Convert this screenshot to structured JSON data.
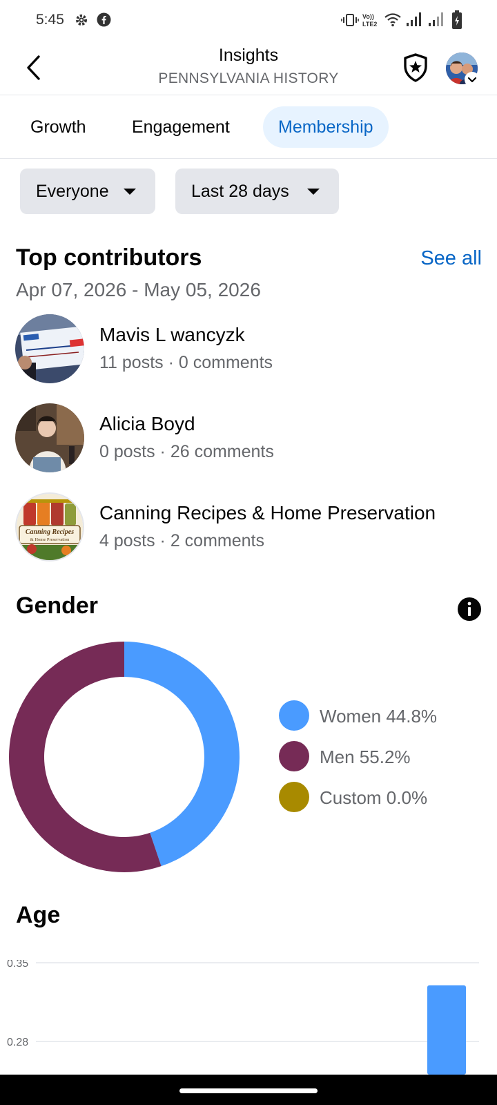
{
  "status_bar": {
    "time": "5:45",
    "left_icons": [
      "gear-icon",
      "facebook-icon"
    ],
    "right_icons": [
      "vibrate-icon",
      "volte-icon",
      "wifi-icon",
      "signal-icon",
      "signal-icon",
      "battery-icon"
    ]
  },
  "header": {
    "title": "Insights",
    "subtitle": "PENNSYLVANIA HISTORY"
  },
  "tabs": [
    {
      "label": "Growth",
      "active": false
    },
    {
      "label": "Engagement",
      "active": false
    },
    {
      "label": "Membership",
      "active": true
    }
  ],
  "filters": {
    "audience": "Everyone",
    "period": "Last 28 days"
  },
  "top_contributors": {
    "title": "Top contributors",
    "see_all": "See all",
    "date_range": "Apr 07, 2026 - May 05, 2026",
    "items": [
      {
        "name": "Mavis L wancyzk",
        "stats": "11 posts · 0 comments"
      },
      {
        "name": "Alicia Boyd",
        "stats": "0 posts · 26 comments"
      },
      {
        "name": "Canning Recipes & Home Preservation",
        "stats": "4 posts · 2 comments",
        "logo_text": [
          "Canning Recipes",
          "& Home Preservation"
        ]
      }
    ]
  },
  "gender": {
    "title": "Gender",
    "legend": [
      {
        "label": "Women 44.8%",
        "color": "#4a9bff"
      },
      {
        "label": "Men 55.2%",
        "color": "#762b56"
      },
      {
        "label": "Custom 0.0%",
        "color": "#a88a00"
      }
    ]
  },
  "age": {
    "title": "Age"
  },
  "colors": {
    "accent": "#0866c6",
    "tab_active_bg": "#e7f3ff",
    "women": "#4a9bff",
    "men": "#762b56",
    "custom": "#a88a00"
  },
  "chart_data": [
    {
      "type": "pie",
      "title": "Gender",
      "categories": [
        "Women",
        "Men",
        "Custom"
      ],
      "values": [
        44.8,
        55.2,
        0.0
      ],
      "unit": "%",
      "colors": [
        "#4a9bff",
        "#762b56",
        "#a88a00"
      ],
      "style": "donut",
      "legend": "right"
    },
    {
      "type": "bar",
      "title": "Age",
      "y_ticks": [
        "0.35",
        "0.28"
      ],
      "values_visible": [
        0.33
      ],
      "color": "#4a9bff",
      "grid": true,
      "note": "partially visible; cut off at bottom of screen"
    }
  ]
}
